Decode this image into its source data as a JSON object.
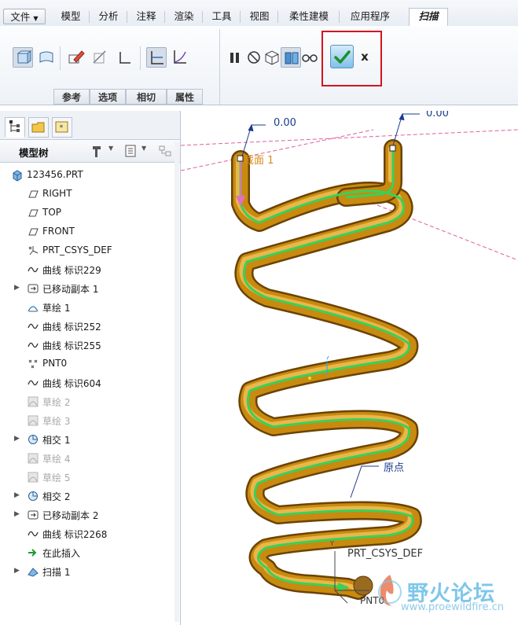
{
  "menubar": {
    "file": "文件",
    "tabs": [
      "模型",
      "分析",
      "注释",
      "渲染",
      "工具",
      "视图",
      "柔性建模",
      "应用程序"
    ],
    "active_tab": "扫描"
  },
  "ribbon": {
    "groups": [
      "参考",
      "选项",
      "相切",
      "属性"
    ],
    "cancel": "x"
  },
  "model_tree": {
    "title": "模型树",
    "root": "123456.PRT",
    "items": [
      {
        "label": "RIGHT",
        "icon": "datum-plane-icon",
        "expandable": false,
        "dim": false
      },
      {
        "label": "TOP",
        "icon": "datum-plane-icon",
        "expandable": false,
        "dim": false
      },
      {
        "label": "FRONT",
        "icon": "datum-plane-icon",
        "expandable": false,
        "dim": false
      },
      {
        "label": "PRT_CSYS_DEF",
        "icon": "csys-icon",
        "expandable": false,
        "dim": false
      },
      {
        "label": "曲线 标识229",
        "icon": "curve-icon",
        "expandable": false,
        "dim": false
      },
      {
        "label": "已移动副本 1",
        "icon": "moved-copy-icon",
        "expandable": true,
        "dim": false
      },
      {
        "label": "草绘 1",
        "icon": "sketch-icon",
        "expandable": false,
        "dim": false
      },
      {
        "label": "曲线 标识252",
        "icon": "curve-icon",
        "expandable": false,
        "dim": false
      },
      {
        "label": "曲线 标识255",
        "icon": "curve-icon",
        "expandable": false,
        "dim": false
      },
      {
        "label": "PNT0",
        "icon": "datum-point-icon",
        "expandable": false,
        "dim": false
      },
      {
        "label": "曲线 标识604",
        "icon": "curve-icon",
        "expandable": false,
        "dim": false
      },
      {
        "label": "草绘 2",
        "icon": "sketch-hidden-icon",
        "expandable": false,
        "dim": true
      },
      {
        "label": "草绘 3",
        "icon": "sketch-hidden-icon",
        "expandable": false,
        "dim": true
      },
      {
        "label": "相交 1",
        "icon": "intersect-icon",
        "expandable": true,
        "dim": false
      },
      {
        "label": "草绘 4",
        "icon": "sketch-hidden-icon",
        "expandable": false,
        "dim": true
      },
      {
        "label": "草绘 5",
        "icon": "sketch-hidden-icon",
        "expandable": false,
        "dim": true
      },
      {
        "label": "相交 2",
        "icon": "intersect-icon",
        "expandable": true,
        "dim": false
      },
      {
        "label": "已移动副本 2",
        "icon": "moved-copy-icon",
        "expandable": true,
        "dim": false
      },
      {
        "label": "曲线 标识2268",
        "icon": "curve-icon",
        "expandable": false,
        "dim": false
      },
      {
        "label": "在此插入",
        "icon": "insert-here-icon",
        "expandable": false,
        "dim": false
      },
      {
        "label": "扫描 1",
        "icon": "sweep-icon",
        "expandable": true,
        "dim": false
      }
    ]
  },
  "viewport": {
    "dim_left": "0.00",
    "dim_right": "0.00",
    "section_label": "截面 1",
    "origin_label": "原点",
    "csys_label": "PRT_CSYS_DEF",
    "point_label": "PNT0",
    "watermark": "野火论坛",
    "watermark_url": "www.proewildfire.cn"
  },
  "colors": {
    "spring": "#c98a10",
    "trajectory": "#38d15a",
    "ok_frame": "#d0161f",
    "datum": "#e05fa0"
  }
}
